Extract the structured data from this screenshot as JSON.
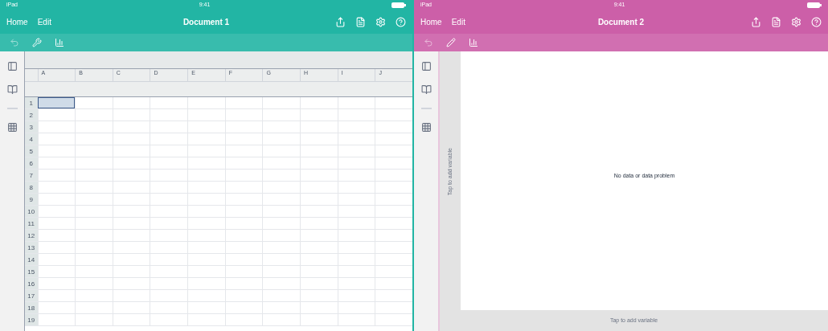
{
  "panes": [
    {
      "kind": "spreadsheet",
      "status": {
        "carrier": "iPad",
        "time": "9:41"
      },
      "nav": {
        "home": "Home",
        "edit": "Edit",
        "title": "Document 1"
      },
      "color": "#22b5a4",
      "columns": [
        "A",
        "B",
        "C",
        "D",
        "E",
        "F",
        "G",
        "H",
        "I",
        "J"
      ],
      "rows": [
        {
          "label": "1",
          "selected": true
        },
        {
          "label": "2",
          "selected": false
        },
        {
          "label": "3",
          "selected": false
        },
        {
          "label": "4",
          "selected": false
        },
        {
          "label": "5",
          "selected": false
        },
        {
          "label": "6",
          "selected": false
        },
        {
          "label": "7",
          "selected": false
        },
        {
          "label": "8",
          "selected": false
        },
        {
          "label": "9",
          "selected": false
        },
        {
          "label": "10",
          "selected": false
        },
        {
          "label": "11",
          "selected": false
        },
        {
          "label": "12",
          "selected": false
        },
        {
          "label": "13",
          "selected": false
        },
        {
          "label": "14",
          "selected": false
        },
        {
          "label": "15",
          "selected": false
        },
        {
          "label": "16",
          "selected": false
        },
        {
          "label": "17",
          "selected": false
        },
        {
          "label": "18",
          "selected": false
        },
        {
          "label": "19",
          "selected": false
        }
      ]
    },
    {
      "kind": "plot",
      "status": {
        "carrier": "iPad",
        "time": "9:41"
      },
      "nav": {
        "home": "Home",
        "edit": "Edit",
        "title": "Document 2"
      },
      "color": "#cc5fa8",
      "y_axis": "Tap to add variable",
      "message": "No data or data problem",
      "x_axis": "Tap to add variable"
    }
  ]
}
